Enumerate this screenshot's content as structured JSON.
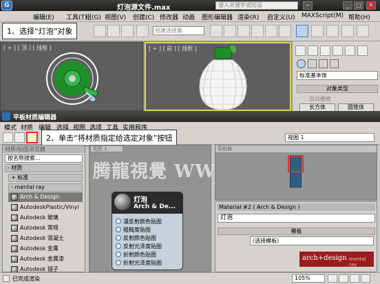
{
  "window": {
    "title": "灯泡源文件.max",
    "search_placeholder": "键入关键字或短语",
    "menus": [
      "编辑(E)",
      "工具(T)",
      "组(G)",
      "视图(V)",
      "创建(C)",
      "修改器",
      "动画",
      "图形编辑器",
      "渲染(R)",
      "自定义(U)",
      "MAXScript(M)",
      "帮助(H)"
    ],
    "selection_set_placeholder": "创建选择集"
  },
  "viewports": {
    "top_label": "[ + ] [ 顶 ] [ 线框 ]",
    "front_label": "[ + ] [ 前 ] [ 线框 ]"
  },
  "command_panel": {
    "dropdown": "标准基本体",
    "rollout": "对象类型",
    "autogrid": "自动栅格",
    "buttons": [
      "长方体",
      "圆锥体"
    ]
  },
  "callouts": {
    "step1": "1、选择“灯泡”对象",
    "step2": "2、单击“将材质指定给选定对象”按钮"
  },
  "slate": {
    "title": "平板材质编辑器",
    "menus": [
      "模式",
      "材质",
      "编辑",
      "选择",
      "视图",
      "选项",
      "工具",
      "实用程序"
    ],
    "view_select": "视图 1",
    "browser_title": "材质/贴图浏览器",
    "search_placeholder": "按名称搜索...",
    "groups": {
      "materials": "- 材质",
      "standard": "+ 标准",
      "mental_ray": "- mental ray"
    },
    "mr_items": [
      "Arch & Design",
      "AutodeskPlastic/Vinyl",
      "Autodesk 玻璃",
      "Autodesk 常规",
      "Autodesk 混凝土",
      "Autodesk 金属",
      "Autodesk 金属漆",
      "Autodesk 镜子"
    ],
    "view_tab": "视图 1",
    "node": {
      "name": "灯泡",
      "type": "Arch & De...",
      "slots": [
        "漫反射颜色贴图",
        "粗糙度贴图",
        "反射颜色贴图",
        "反射光泽度贴图",
        "折射颜色贴图",
        "折射光泽度贴图"
      ]
    },
    "navigator_title": "导航器",
    "material_header": "Material #2 ( Arch & Design )",
    "material_name": "灯泡",
    "templates_rollout": "模板",
    "template_select": "(选择模板)",
    "brand": "arch+design",
    "brand_sub": "mental ray",
    "status": "已完成渲染",
    "zoom": "105%"
  },
  "watermark": "腾龍視覺 WWW.TLAVI.NET",
  "colors": {
    "accent": "#2d6fb7",
    "highlight": "#e8a9a9",
    "callout_border": "#e03030"
  }
}
